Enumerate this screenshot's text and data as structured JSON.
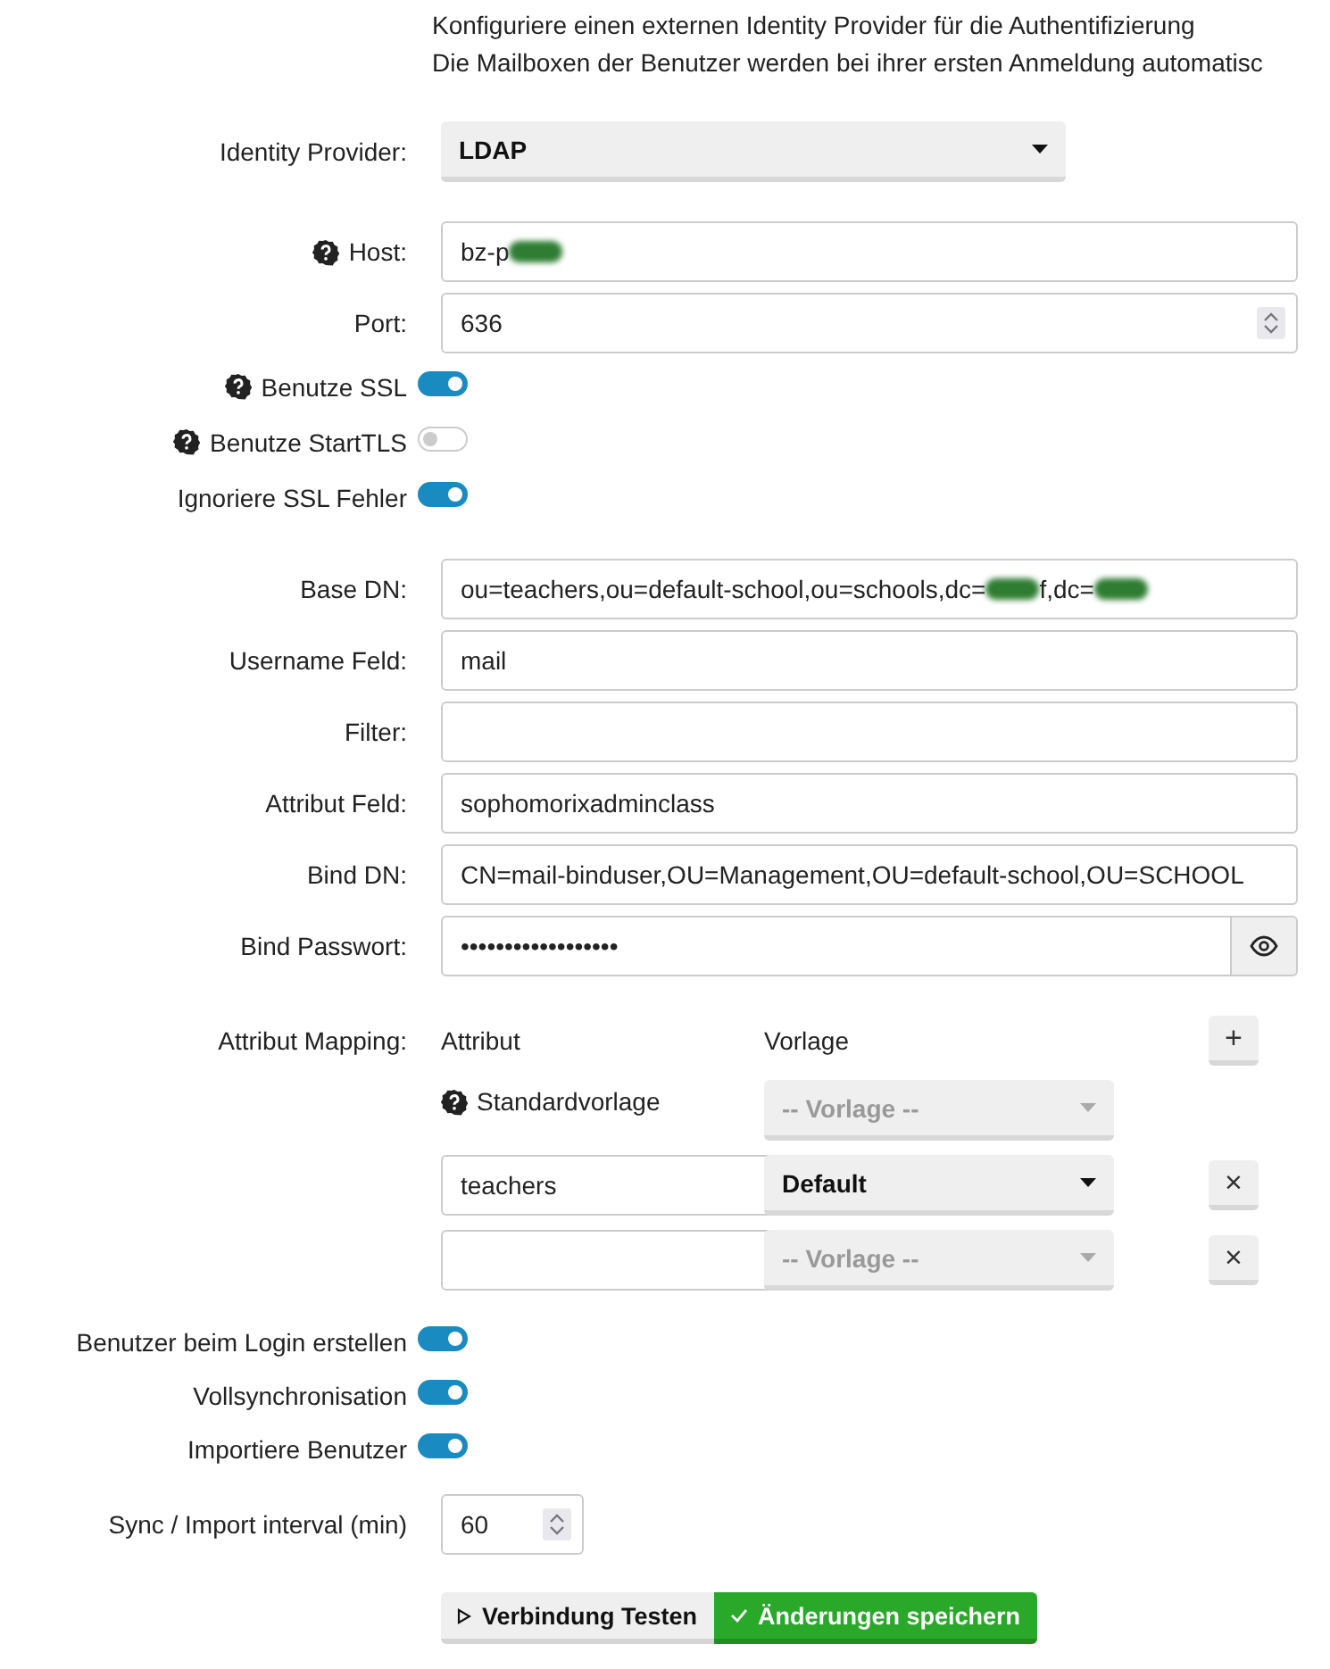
{
  "intro": [
    "Konfiguriere einen externen Identity Provider für die Authentifizierung",
    "Die Mailboxen der Benutzer werden bei ihrer ersten Anmeldung automatisc"
  ],
  "sections": [
    [
      {
        "kind": "select",
        "label": "Identity Provider:",
        "value": "LDAP"
      }
    ],
    [
      {
        "kind": "text",
        "label": "Host:",
        "help": true,
        "segments": [
          {
            "kind": "text",
            "text": "bz-p"
          },
          {
            "kind": "redacted"
          }
        ]
      },
      {
        "kind": "number",
        "label": "Port:",
        "value": "636"
      },
      {
        "kind": "toggle",
        "label": "Benutze SSL",
        "help": true,
        "on": true
      },
      {
        "kind": "toggle",
        "label": "Benutze StartTLS",
        "help": true,
        "on": false
      },
      {
        "kind": "toggle",
        "label": "Ignoriere SSL Fehler",
        "on": true
      }
    ],
    [
      {
        "kind": "text",
        "label": "Base DN:",
        "segments": [
          {
            "kind": "text",
            "text": "ou=teachers,ou=default-school,ou=schools,dc="
          },
          {
            "kind": "redacted"
          },
          {
            "kind": "text",
            "text": "f,dc="
          },
          {
            "kind": "redacted"
          }
        ]
      },
      {
        "kind": "text",
        "label": "Username Feld:",
        "value": "mail"
      },
      {
        "kind": "text",
        "label": "Filter:"
      },
      {
        "kind": "text",
        "label": "Attribut Feld:",
        "value": "sophomorixadminclass"
      },
      {
        "kind": "text",
        "label": "Bind DN:",
        "value": "CN=mail-binduser,OU=Management,OU=default-school,OU=SCHOOL"
      },
      {
        "kind": "password",
        "label": "Bind Passwort:",
        "value": "••••••••••••••••••"
      }
    ]
  ],
  "attribute_mapping": {
    "label": "Attribut Mapping:",
    "columns": [
      "Attribut",
      "Vorlage"
    ],
    "add_button": "+",
    "default_row": {
      "label": "Standardvorlage",
      "help": true,
      "template": {
        "placeholder": "-- Vorlage --"
      }
    },
    "rows": [
      {
        "attribute": "teachers",
        "template": {
          "value": "Default"
        },
        "remove_button": "×"
      },
      {
        "template": {
          "placeholder": "-- Vorlage --"
        },
        "remove_button": "×"
      }
    ]
  },
  "sync_section": [
    {
      "kind": "toggle",
      "label": "Benutzer beim Login erstellen",
      "on": true
    },
    {
      "kind": "toggle",
      "label": "Vollsynchronisation",
      "on": true
    },
    {
      "kind": "toggle",
      "label": "Importiere Benutzer",
      "on": true
    },
    {
      "kind": "number",
      "label": "Sync / Import interval (min)",
      "value": "60"
    }
  ],
  "buttons": [
    {
      "kind": "secondary",
      "label": "Verbindung Testen"
    },
    {
      "kind": "primary",
      "label": "Änderungen speichern"
    }
  ]
}
